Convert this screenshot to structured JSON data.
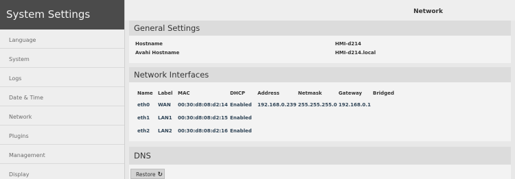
{
  "sidebar": {
    "title": "System Settings",
    "items": [
      "Language",
      "System",
      "Logs",
      "Date & Time",
      "Network",
      "Plugins",
      "Management",
      "Display"
    ]
  },
  "header": {
    "title": "Network"
  },
  "general": {
    "heading": "General Settings",
    "hostname_label": "Hostname",
    "hostname_value": "HMI-d214",
    "avahi_label": "Avahi Hostname",
    "avahi_value": "HMI-d214.local"
  },
  "interfaces": {
    "heading": "Network Interfaces",
    "columns": [
      "Name",
      "Label",
      "MAC",
      "DHCP",
      "Address",
      "Netmask",
      "Gateway",
      "Bridged"
    ],
    "rows": [
      [
        "eth0",
        "WAN",
        "00:30:d8:08:d2:14",
        "Enabled",
        "192.168.0.239",
        "255.255.255.0",
        "192.168.0.1",
        ""
      ],
      [
        "eth1",
        "LAN1",
        "00:30:d8:08:d2:15",
        "Enabled",
        "",
        "",
        "",
        ""
      ],
      [
        "eth2",
        "LAN2",
        "00:30:d8:08:d2:16",
        "Enabled",
        "",
        "",
        "",
        ""
      ]
    ]
  },
  "dns": {
    "heading": "DNS"
  },
  "actions": {
    "restore_label": "Restore",
    "restore_icon": "refresh-icon"
  }
}
